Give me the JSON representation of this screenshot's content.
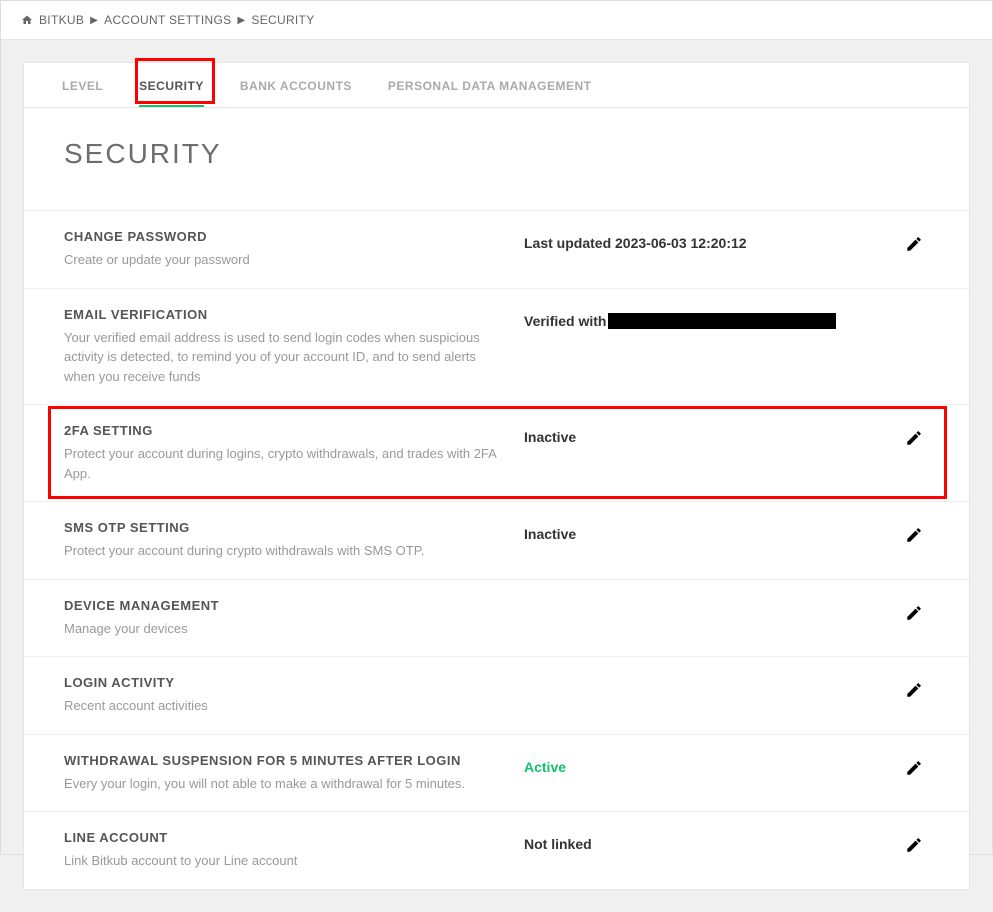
{
  "breadcrumb": {
    "items": [
      "BITKUB",
      "ACCOUNT SETTINGS",
      "SECURITY"
    ]
  },
  "tabs": [
    {
      "label": "LEVEL",
      "active": false
    },
    {
      "label": "SECURITY",
      "active": true
    },
    {
      "label": "BANK ACCOUNTS",
      "active": false
    },
    {
      "label": "PERSONAL DATA MANAGEMENT",
      "active": false
    }
  ],
  "page_title": "SECURITY",
  "settings": {
    "change_password": {
      "title": "CHANGE PASSWORD",
      "desc": "Create or update your password",
      "status": "Last updated 2023-06-03 12:20:12"
    },
    "email_verification": {
      "title": "EMAIL VERIFICATION",
      "desc": "Your verified email address is used to send login codes when suspicious activity is detected, to remind you of your account ID, and to send alerts when you receive funds",
      "status_prefix": "Verified with"
    },
    "twofa": {
      "title": "2FA SETTING",
      "desc": "Protect your account during logins, crypto withdrawals, and trades with 2FA App.",
      "status": "Inactive"
    },
    "sms_otp": {
      "title": "SMS OTP SETTING",
      "desc": "Protect your account during crypto withdrawals with SMS OTP.",
      "status": "Inactive"
    },
    "device_mgmt": {
      "title": "DEVICE MANAGEMENT",
      "desc": "Manage your devices",
      "status": ""
    },
    "login_activity": {
      "title": "LOGIN ACTIVITY",
      "desc": "Recent account activities",
      "status": ""
    },
    "withdrawal_suspension": {
      "title": "WITHDRAWAL SUSPENSION FOR 5 MINUTES AFTER LOGIN",
      "desc": "Every your login, you will not able to make a withdrawal for 5 minutes.",
      "status": "Active"
    },
    "line_account": {
      "title": "LINE ACCOUNT",
      "desc": "Link Bitkub account to your Line account",
      "status": "Not linked"
    }
  }
}
